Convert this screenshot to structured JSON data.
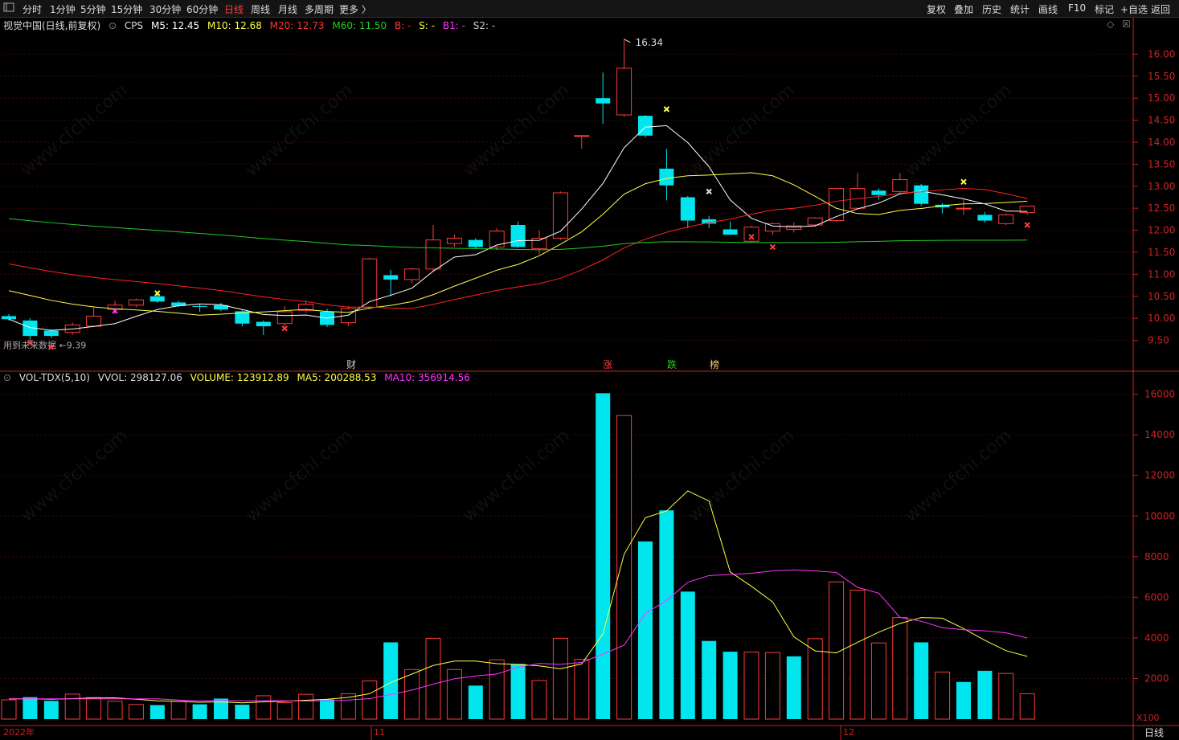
{
  "toolbar": {
    "left_icon": "layout-toggle-icon",
    "periods": [
      "分时",
      "1分钟",
      "5分钟",
      "15分钟",
      "30分钟",
      "60分钟",
      "日线",
      "周线",
      "月线",
      "多周期",
      "更多 〉"
    ],
    "active_period": "日线",
    "right_buttons": [
      "复权",
      "叠加",
      "历史",
      "统计",
      "画线",
      "F10",
      "标记",
      "+自选",
      "返回"
    ]
  },
  "price_header": {
    "stock": "视觉中国(日线,前复权)",
    "indicator": "CPS",
    "ma5": "M5: 12.45",
    "ma10": "M10: 12.68",
    "ma20": "M20: 12.73",
    "ma60": "M60: 11.50",
    "b": "B: -",
    "s": "S: -",
    "b1": "B1: -",
    "s2": "S2: -"
  },
  "vol_header": {
    "name": "VOL-TDX(5,10)",
    "vvol": "VVOL: 298127.06",
    "volume": "VOLUME: 123912.89",
    "ma5": "MA5: 200288.53",
    "ma10": "MA10: 356914.56"
  },
  "colors": {
    "up": "#ff3b3b",
    "down": "#00e5ee",
    "ma5": "#ffffff",
    "ma10": "#ffff44",
    "ma20": "#ff2222",
    "ma60": "#22cc22",
    "vol_ma5": "#ffff44",
    "vol_ma10": "#ff33ff",
    "axis": "#cc2222"
  },
  "annotations": {
    "high_label": "16.34",
    "low_label": "9.39",
    "low_prefix": "用到未来数据",
    "events": [
      {
        "text": "财",
        "color": "#cccccc"
      },
      {
        "text": "涨",
        "color": "#ff3b3b"
      },
      {
        "text": "跌",
        "color": "#22cc22"
      },
      {
        "text": "榜",
        "color": "#ffcc66"
      }
    ],
    "x_labels": [
      "2022年",
      "11",
      "12"
    ],
    "vol_unit": "X100",
    "period_label": "日线"
  },
  "chart_data": [
    {
      "type": "candlestick",
      "ylim": [
        9.2,
        16.5
      ],
      "yticks": [
        9.5,
        10.0,
        10.5,
        11.0,
        11.5,
        12.0,
        12.5,
        13.0,
        13.5,
        14.0,
        14.5,
        15.0,
        15.5,
        16.0
      ],
      "ohlc": [
        [
          10.05,
          10.1,
          9.95,
          9.98
        ],
        [
          9.95,
          10.0,
          9.5,
          9.6
        ],
        [
          9.72,
          9.75,
          9.55,
          9.6
        ],
        [
          9.68,
          9.9,
          9.62,
          9.85
        ],
        [
          9.82,
          10.25,
          9.8,
          10.05
        ],
        [
          10.2,
          10.4,
          10.1,
          10.3
        ],
        [
          10.3,
          10.45,
          10.25,
          10.42
        ],
        [
          10.5,
          10.6,
          10.35,
          10.38
        ],
        [
          10.36,
          10.4,
          10.25,
          10.28
        ],
        [
          10.28,
          10.32,
          10.15,
          10.26
        ],
        [
          10.3,
          10.35,
          10.16,
          10.2
        ],
        [
          10.16,
          10.2,
          9.82,
          9.88
        ],
        [
          9.92,
          9.95,
          9.62,
          9.82
        ],
        [
          9.88,
          10.28,
          9.82,
          10.15
        ],
        [
          10.18,
          10.4,
          10.12,
          10.32
        ],
        [
          10.15,
          10.22,
          9.8,
          9.85
        ],
        [
          9.9,
          10.28,
          9.82,
          10.22
        ],
        [
          10.25,
          11.38,
          10.2,
          11.35
        ],
        [
          10.98,
          11.1,
          10.5,
          10.88
        ],
        [
          10.88,
          11.15,
          10.8,
          11.12
        ],
        [
          11.12,
          12.12,
          11.05,
          11.78
        ],
        [
          11.7,
          11.9,
          11.62,
          11.82
        ],
        [
          11.78,
          11.82,
          11.58,
          11.62
        ],
        [
          11.62,
          12.05,
          11.55,
          11.98
        ],
        [
          12.12,
          12.2,
          11.6,
          11.62
        ],
        [
          11.58,
          12.0,
          11.45,
          11.82
        ],
        [
          11.82,
          12.88,
          11.78,
          12.85
        ],
        [
          14.15,
          14.15,
          13.85,
          14.15
        ],
        [
          15.0,
          15.58,
          14.42,
          14.88
        ],
        [
          14.62,
          16.34,
          14.58,
          15.68
        ],
        [
          14.6,
          14.62,
          14.1,
          14.15
        ],
        [
          13.4,
          13.85,
          12.68,
          13.02
        ],
        [
          12.75,
          12.78,
          12.05,
          12.22
        ],
        [
          12.25,
          12.32,
          12.05,
          12.15
        ],
        [
          12.02,
          12.2,
          11.9,
          11.9
        ],
        [
          11.75,
          12.1,
          11.72,
          12.07
        ],
        [
          11.98,
          12.18,
          11.9,
          12.15
        ],
        [
          12.02,
          12.18,
          11.95,
          12.1
        ],
        [
          12.12,
          12.3,
          12.08,
          12.28
        ],
        [
          12.22,
          12.95,
          12.18,
          12.95
        ],
        [
          12.5,
          13.3,
          12.48,
          12.95
        ],
        [
          12.9,
          12.95,
          12.7,
          12.8
        ],
        [
          12.88,
          13.3,
          12.82,
          13.15
        ],
        [
          13.02,
          13.05,
          12.55,
          12.6
        ],
        [
          12.58,
          12.62,
          12.38,
          12.52
        ],
        [
          12.5,
          12.7,
          12.35,
          12.5
        ],
        [
          12.35,
          12.42,
          12.18,
          12.22
        ],
        [
          12.15,
          12.38,
          12.12,
          12.35
        ],
        [
          12.4,
          12.55,
          12.35,
          12.55
        ]
      ],
      "ma_values": {
        "M5": 12.45,
        "M10": 12.68,
        "M20": 12.73,
        "M60": 11.5
      }
    },
    {
      "type": "bar",
      "ylabel": "X100",
      "ylim": [
        0,
        16500
      ],
      "yticks": [
        2000,
        4000,
        6000,
        8000,
        10000,
        12000,
        14000,
        16000
      ],
      "values": [
        950,
        1080,
        900,
        1230,
        1060,
        880,
        720,
        690,
        870,
        730,
        1010,
        710,
        1150,
        810,
        1220,
        970,
        1250,
        1880,
        3780,
        2440,
        3980,
        2440,
        1650,
        2920,
        2720,
        1900,
        3980,
        2940,
        16050,
        14950,
        8750,
        10280,
        6280,
        3850,
        3320,
        3300,
        3280,
        3090,
        3960,
        6760,
        6350,
        3750,
        5000,
        3780,
        2320,
        1830,
        2380,
        2250,
        1250
      ],
      "up": [
        true,
        false,
        false,
        true,
        true,
        true,
        true,
        false,
        true,
        false,
        false,
        false,
        true,
        true,
        true,
        false,
        true,
        true,
        false,
        true,
        true,
        true,
        false,
        true,
        false,
        true,
        true,
        true,
        false,
        true,
        false,
        false,
        false,
        false,
        false,
        true,
        true,
        false,
        true,
        true,
        true,
        true,
        true,
        false,
        true,
        false,
        false,
        true,
        true
      ],
      "ma5": [
        1000,
        1000,
        980,
        1010,
        1040,
        1050,
        980,
        900,
        870,
        830,
        850,
        800,
        850,
        880,
        930,
        980,
        1070,
        1250,
        1800,
        2220,
        2640,
        2860,
        2860,
        2730,
        2690,
        2620,
        2480,
        2720,
        4200,
        8120,
        9920,
        10250,
        11240,
        10740,
        7250,
        6540,
        5770,
        4050,
        3360,
        3260,
        3780,
        4280,
        4710,
        5000,
        4970,
        4460,
        3880,
        3370,
        3090
      ],
      "ma10": [
        1000,
        1000,
        1000,
        1000,
        1000,
        1000,
        1000,
        1000,
        940,
        900,
        920,
        900,
        910,
        900,
        890,
        900,
        940,
        1010,
        1210,
        1430,
        1720,
        1990,
        2120,
        2220,
        2560,
        2740,
        2700,
        2790,
        3200,
        3640,
        5210,
        5840,
        6740,
        7070,
        7120,
        7180,
        7300,
        7350,
        7300,
        7220,
        6490,
        6200,
        5010,
        4820,
        4500,
        4400,
        4350,
        4250,
        3990
      ]
    }
  ]
}
